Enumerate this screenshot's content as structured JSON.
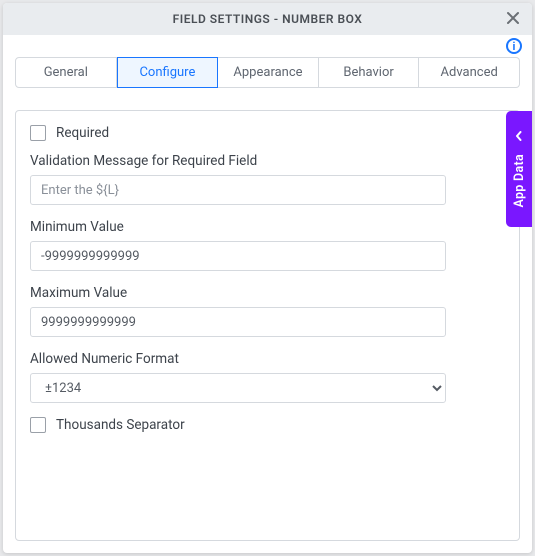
{
  "colors": {
    "accent_blue": "#1976ff",
    "accent_purple": "#7a17ff"
  },
  "titlebar": {
    "title": "FIELD SETTINGS - NUMBER BOX"
  },
  "info_icon_glyph": "i",
  "tabs": {
    "general": {
      "label": "General"
    },
    "configure": {
      "label": "Configure"
    },
    "appearance": {
      "label": "Appearance"
    },
    "behavior": {
      "label": "Behavior"
    },
    "advanced": {
      "label": "Advanced"
    },
    "active": "configure"
  },
  "form": {
    "required": {
      "label": "Required",
      "checked": false
    },
    "validation_msg": {
      "label": "Validation Message for Required Field",
      "placeholder": "Enter the ${L}",
      "value": ""
    },
    "min_value": {
      "label": "Minimum Value",
      "value": "-9999999999999"
    },
    "max_value": {
      "label": "Maximum Value",
      "value": "9999999999999"
    },
    "numeric_format": {
      "label": "Allowed Numeric Format",
      "selected": "±1234"
    },
    "thousands_sep": {
      "label": "Thousands Separator",
      "checked": false
    }
  },
  "sidebar": {
    "appdata_label": "App Data"
  }
}
